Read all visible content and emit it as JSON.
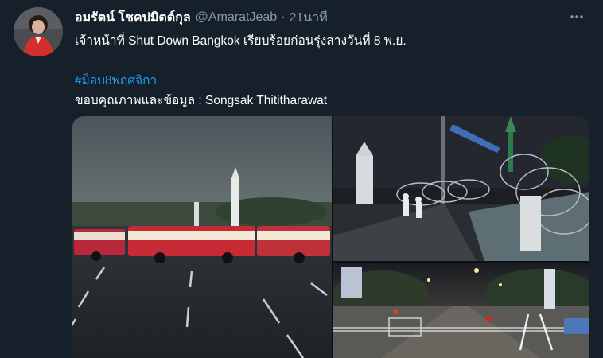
{
  "tweet": {
    "author_name": "อมรัตน์ โชคปมิตต์กุล",
    "handle": "@AmaratJeab",
    "separator": "·",
    "time": "21นาที",
    "text_line1": "เจ้าหน้าที่ Shut Down Bangkok เรียบร้อยก่อนรุ่งสางวันที่ 8 พ.ย.",
    "hashtag": "#ม็อบ8พฤศจิกา",
    "credit_line": "ขอบคุณภาพและข้อมูล :  Songsak Thititharawat"
  },
  "icons": {
    "more": "more-options-icon",
    "avatar": "profile-avatar"
  },
  "colors": {
    "background": "#15202b",
    "secondary_text": "#8899a6",
    "link": "#1da1f2"
  }
}
